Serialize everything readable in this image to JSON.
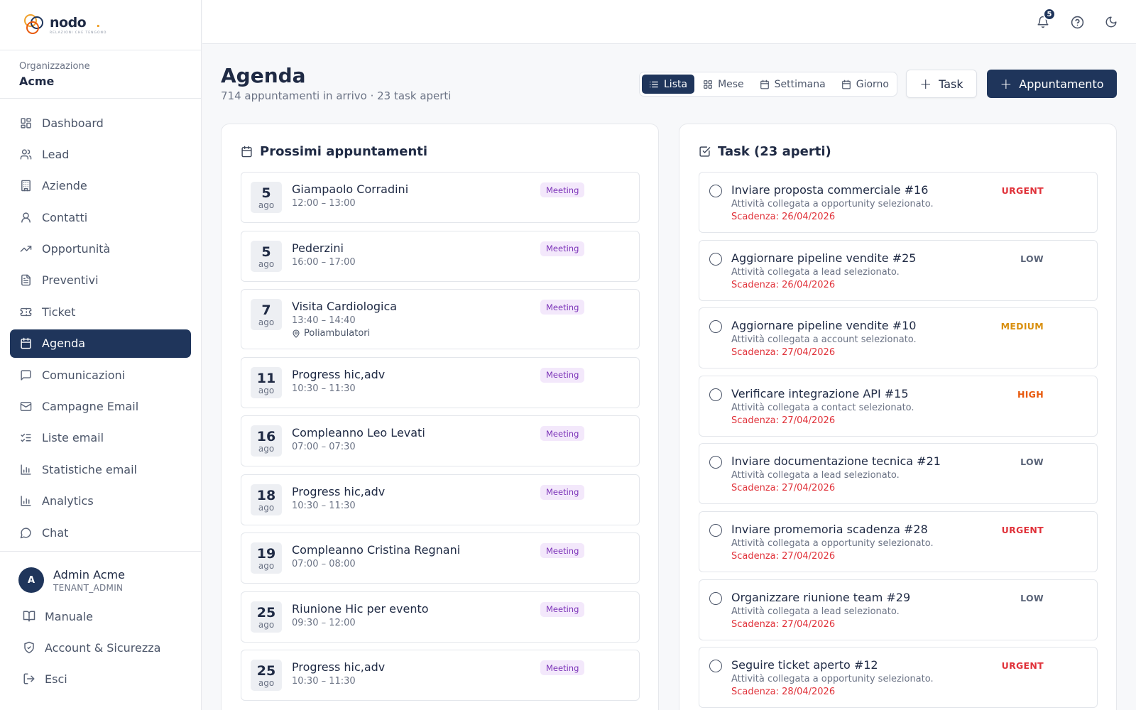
{
  "brand": {
    "name": "nodo",
    "tagline": "RELAZIONI CHE TENGONO"
  },
  "org": {
    "label": "Organizzazione",
    "name": "Acme"
  },
  "nav": [
    {
      "label": "Dashboard",
      "icon": "dashboard-icon"
    },
    {
      "label": "Lead",
      "icon": "users-icon"
    },
    {
      "label": "Aziende",
      "icon": "building-icon"
    },
    {
      "label": "Contatti",
      "icon": "user-icon"
    },
    {
      "label": "Opportunità",
      "icon": "trending-up-icon"
    },
    {
      "label": "Preventivi",
      "icon": "document-icon"
    },
    {
      "label": "Ticket",
      "icon": "ticket-icon"
    },
    {
      "label": "Agenda",
      "icon": "calendar-icon",
      "active": true
    },
    {
      "label": "Comunicazioni",
      "icon": "message-square-icon"
    },
    {
      "label": "Campagne Email",
      "icon": "mail-icon"
    },
    {
      "label": "Liste email",
      "icon": "list-checks-icon"
    },
    {
      "label": "Statistiche email",
      "icon": "bar-chart-icon"
    },
    {
      "label": "Analytics",
      "icon": "bar-chart-icon"
    },
    {
      "label": "Chat",
      "icon": "chat-bubble-icon"
    }
  ],
  "user": {
    "initial": "A",
    "name": "Admin Acme",
    "role": "TENANT_ADMIN"
  },
  "bottom_links": [
    {
      "label": "Manuale",
      "icon": "book-icon"
    },
    {
      "label": "Account & Sicurezza",
      "icon": "shield-icon"
    },
    {
      "label": "Esci",
      "icon": "logout-icon"
    }
  ],
  "topbar": {
    "notifications_count": "5"
  },
  "header": {
    "title": "Agenda",
    "subtitle": "714 appuntamenti in arrivo · 23 task aperti",
    "views": [
      {
        "label": "Lista",
        "icon": "list-icon",
        "active": true
      },
      {
        "label": "Mese",
        "icon": "grid-icon"
      },
      {
        "label": "Settimana",
        "icon": "calendar-icon"
      },
      {
        "label": "Giorno",
        "icon": "calendar-icon"
      }
    ],
    "task_button": "Task",
    "appointment_button": "Appuntamento"
  },
  "appointments": {
    "title": "Prossimi appuntamenti",
    "items": [
      {
        "day": "5",
        "month": "ago",
        "title": "Giampaolo Corradini",
        "time": "12:00 – 13:00",
        "tag": "Meeting"
      },
      {
        "day": "5",
        "month": "ago",
        "title": "Pederzini",
        "time": "16:00 – 17:00",
        "tag": "Meeting"
      },
      {
        "day": "7",
        "month": "ago",
        "title": "Visita Cardiologica",
        "time": "13:40 – 14:40",
        "location": "Poliambulatori",
        "tag": "Meeting"
      },
      {
        "day": "11",
        "month": "ago",
        "title": "Progress hic,adv",
        "time": "10:30 – 11:30",
        "tag": "Meeting"
      },
      {
        "day": "16",
        "month": "ago",
        "title": "Compleanno Leo Levati",
        "time": "07:00 – 07:30",
        "tag": "Meeting"
      },
      {
        "day": "18",
        "month": "ago",
        "title": "Progress hic,adv",
        "time": "10:30 – 11:30",
        "tag": "Meeting"
      },
      {
        "day": "19",
        "month": "ago",
        "title": "Compleanno Cristina Regnani",
        "time": "07:00 – 08:00",
        "tag": "Meeting"
      },
      {
        "day": "25",
        "month": "ago",
        "title": "Riunione Hic per evento",
        "time": "09:30 – 12:00",
        "tag": "Meeting"
      },
      {
        "day": "25",
        "month": "ago",
        "title": "Progress hic,adv",
        "time": "10:30 – 11:30",
        "tag": "Meeting"
      }
    ]
  },
  "tasks": {
    "title": "Task (23 aperti)",
    "priority_colors": {
      "URGENT": "#e0323a",
      "LOW": "#5a6478",
      "MEDIUM": "#d9900f",
      "HIGH": "#e8590c"
    },
    "items": [
      {
        "title": "Inviare proposta commerciale #16",
        "desc": "Attività collegata a opportunity selezionato.",
        "due": "Scadenza: 26/04/2026",
        "priority": "URGENT"
      },
      {
        "title": "Aggiornare pipeline vendite #25",
        "desc": "Attività collegata a lead selezionato.",
        "due": "Scadenza: 26/04/2026",
        "priority": "LOW"
      },
      {
        "title": "Aggiornare pipeline vendite #10",
        "desc": "Attività collegata a account selezionato.",
        "due": "Scadenza: 27/04/2026",
        "priority": "MEDIUM"
      },
      {
        "title": "Verificare integrazione API #15",
        "desc": "Attività collegata a contact selezionato.",
        "due": "Scadenza: 27/04/2026",
        "priority": "HIGH"
      },
      {
        "title": "Inviare documentazione tecnica #21",
        "desc": "Attività collegata a lead selezionato.",
        "due": "Scadenza: 27/04/2026",
        "priority": "LOW"
      },
      {
        "title": "Inviare promemoria scadenza #28",
        "desc": "Attività collegata a opportunity selezionato.",
        "due": "Scadenza: 27/04/2026",
        "priority": "URGENT"
      },
      {
        "title": "Organizzare riunione team #29",
        "desc": "Attività collegata a lead selezionato.",
        "due": "Scadenza: 27/04/2026",
        "priority": "LOW"
      },
      {
        "title": "Seguire ticket aperto #12",
        "desc": "Attività collegata a opportunity selezionato.",
        "due": "Scadenza: 28/04/2026",
        "priority": "URGENT"
      }
    ]
  }
}
